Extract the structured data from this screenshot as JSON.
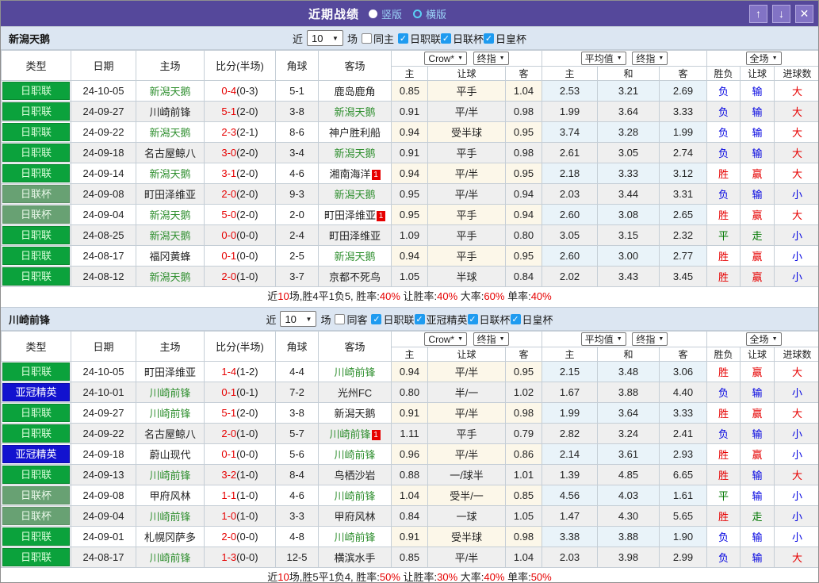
{
  "titlebar": {
    "title": "近期战绩",
    "radio_vertical": "竖版",
    "radio_horizontal": "横版",
    "up_glyph": "↑",
    "down_glyph": "↓",
    "close_glyph": "✕"
  },
  "columns": {
    "type": "类型",
    "date": "日期",
    "home": "主场",
    "score": "比分(半场)",
    "corner": "角球",
    "away": "客场",
    "handicap_src": "Crow*",
    "handicap_idx": "终指",
    "let_sub": [
      "主",
      "让球",
      "客"
    ],
    "avg_src": "平均值",
    "avg_idx": "终指",
    "avg_sub": [
      "主",
      "和",
      "客"
    ],
    "full_src": "全场",
    "full_sub": [
      "胜负",
      "让球",
      "进球数"
    ]
  },
  "colors": {
    "titlebar_bg": "#55489B",
    "titlebar_btn_bg": "#8273C5",
    "titlebar_btn_border": "#B3A8DF",
    "radio_label": "#9AD2F7",
    "section_header_bg": "#DCE6F2",
    "grid_border": "#C5CED6",
    "row_alt": "#EFEFEF",
    "col_let": "#FCF7E9",
    "col_avg": "#E9F3F9",
    "checkbox_blue": "#1E9BF0",
    "league_jl_bg": "#0BA23C",
    "league_jl_border": "#0A8830",
    "league_jl_text": "#DCFFDC",
    "league_cup_bg": "#68A173",
    "league_cup_border": "#5C9066",
    "league_cup_text": "#E8F7E8",
    "league_acl_bg": "#1212CF",
    "league_acl_border": "#0B0BA8",
    "team_hl": "#2F8F2F",
    "red": "#E60000",
    "blue": "#0000E0",
    "green": "#007800"
  },
  "sections": [
    {
      "team": "新潟天鹅",
      "filter": {
        "near_label": "近",
        "count": "10",
        "games_label": "场",
        "same_label": "同主",
        "same_checked": false,
        "leagues": [
          {
            "label": "日职联",
            "checked": true
          },
          {
            "label": "日联杯",
            "checked": true
          },
          {
            "label": "日皇杯",
            "checked": true
          }
        ]
      },
      "rows": [
        {
          "league": "日职联",
          "date": "24-10-05",
          "home": "新潟天鹅",
          "hh": true,
          "hrc": false,
          "score": "0-4",
          "half": "(0-3)",
          "corner": "5-1",
          "away": "鹿岛鹿角",
          "ah": false,
          "arc": false,
          "let": [
            "0.85",
            "平手",
            "1.04"
          ],
          "avg": [
            "2.53",
            "3.21",
            "2.69"
          ],
          "res": [
            "负",
            "输",
            "大"
          ]
        },
        {
          "league": "日职联",
          "date": "24-09-27",
          "home": "川崎前锋",
          "hh": false,
          "hrc": false,
          "score": "5-1",
          "half": "(2-0)",
          "corner": "3-8",
          "away": "新潟天鹅",
          "ah": true,
          "arc": false,
          "let": [
            "0.91",
            "平/半",
            "0.98"
          ],
          "avg": [
            "1.99",
            "3.64",
            "3.33"
          ],
          "res": [
            "负",
            "输",
            "大"
          ]
        },
        {
          "league": "日职联",
          "date": "24-09-22",
          "home": "新潟天鹅",
          "hh": true,
          "hrc": false,
          "score": "2-3",
          "half": "(2-1)",
          "corner": "8-6",
          "away": "神户胜利船",
          "ah": false,
          "arc": false,
          "let": [
            "0.94",
            "受半球",
            "0.95"
          ],
          "avg": [
            "3.74",
            "3.28",
            "1.99"
          ],
          "res": [
            "负",
            "输",
            "大"
          ]
        },
        {
          "league": "日职联",
          "date": "24-09-18",
          "home": "名古屋鲸八",
          "hh": false,
          "hrc": false,
          "score": "3-0",
          "half": "(2-0)",
          "corner": "3-4",
          "away": "新潟天鹅",
          "ah": true,
          "arc": false,
          "let": [
            "0.91",
            "平手",
            "0.98"
          ],
          "avg": [
            "2.61",
            "3.05",
            "2.74"
          ],
          "res": [
            "负",
            "输",
            "大"
          ]
        },
        {
          "league": "日职联",
          "date": "24-09-14",
          "home": "新潟天鹅",
          "hh": true,
          "hrc": false,
          "score": "3-1",
          "half": "(2-0)",
          "corner": "4-6",
          "away": "湘南海洋",
          "ah": false,
          "arc": true,
          "let": [
            "0.94",
            "平/半",
            "0.95"
          ],
          "avg": [
            "2.18",
            "3.33",
            "3.12"
          ],
          "res": [
            "胜",
            "赢",
            "大"
          ]
        },
        {
          "league": "日联杯",
          "date": "24-09-08",
          "home": "町田泽维亚",
          "hh": false,
          "hrc": false,
          "score": "2-0",
          "half": "(2-0)",
          "corner": "9-3",
          "away": "新潟天鹅",
          "ah": true,
          "arc": false,
          "let": [
            "0.95",
            "平/半",
            "0.94"
          ],
          "avg": [
            "2.03",
            "3.44",
            "3.31"
          ],
          "res": [
            "负",
            "输",
            "小"
          ]
        },
        {
          "league": "日联杯",
          "date": "24-09-04",
          "home": "新潟天鹅",
          "hh": true,
          "hrc": false,
          "score": "5-0",
          "half": "(2-0)",
          "corner": "2-0",
          "away": "町田泽维亚",
          "ah": false,
          "arc": true,
          "let": [
            "0.95",
            "平手",
            "0.94"
          ],
          "avg": [
            "2.60",
            "3.08",
            "2.65"
          ],
          "res": [
            "胜",
            "赢",
            "大"
          ]
        },
        {
          "league": "日职联",
          "date": "24-08-25",
          "home": "新潟天鹅",
          "hh": true,
          "hrc": false,
          "score": "0-0",
          "half": "(0-0)",
          "corner": "2-4",
          "away": "町田泽维亚",
          "ah": false,
          "arc": false,
          "let": [
            "1.09",
            "平手",
            "0.80"
          ],
          "avg": [
            "3.05",
            "3.15",
            "2.32"
          ],
          "res": [
            "平",
            "走",
            "小"
          ]
        },
        {
          "league": "日职联",
          "date": "24-08-17",
          "home": "福冈黄蜂",
          "hh": false,
          "hrc": false,
          "score": "0-1",
          "half": "(0-0)",
          "corner": "2-5",
          "away": "新潟天鹅",
          "ah": true,
          "arc": false,
          "let": [
            "0.94",
            "平手",
            "0.95"
          ],
          "avg": [
            "2.60",
            "3.00",
            "2.77"
          ],
          "res": [
            "胜",
            "赢",
            "小"
          ]
        },
        {
          "league": "日职联",
          "date": "24-08-12",
          "home": "新潟天鹅",
          "hh": true,
          "hrc": false,
          "score": "2-0",
          "half": "(1-0)",
          "corner": "3-7",
          "away": "京都不死鸟",
          "ah": false,
          "arc": false,
          "let": [
            "1.05",
            "半球",
            "0.84"
          ],
          "avg": [
            "2.02",
            "3.43",
            "3.45"
          ],
          "res": [
            "胜",
            "赢",
            "小"
          ]
        }
      ],
      "summary": [
        {
          "t": "近"
        },
        {
          "t": "10",
          "red": true
        },
        {
          "t": "场,胜4平1负5, 胜率:"
        },
        {
          "t": "40%",
          "red": true
        },
        {
          "t": " 让胜率:"
        },
        {
          "t": "40%",
          "red": true
        },
        {
          "t": " 大率:"
        },
        {
          "t": "60%",
          "red": true
        },
        {
          "t": " 单率:"
        },
        {
          "t": "40%",
          "red": true
        }
      ]
    },
    {
      "team": "川崎前锋",
      "filter": {
        "near_label": "近",
        "count": "10",
        "games_label": "场",
        "same_label": "同客",
        "same_checked": false,
        "leagues": [
          {
            "label": "日职联",
            "checked": true
          },
          {
            "label": "亚冠精英",
            "checked": true
          },
          {
            "label": "日联杯",
            "checked": true
          },
          {
            "label": "日皇杯",
            "checked": true
          }
        ]
      },
      "rows": [
        {
          "league": "日职联",
          "date": "24-10-05",
          "home": "町田泽维亚",
          "hh": false,
          "hrc": false,
          "score": "1-4",
          "half": "(1-2)",
          "corner": "4-4",
          "away": "川崎前锋",
          "ah": true,
          "arc": false,
          "let": [
            "0.94",
            "平/半",
            "0.95"
          ],
          "avg": [
            "2.15",
            "3.48",
            "3.06"
          ],
          "res": [
            "胜",
            "赢",
            "大"
          ]
        },
        {
          "league": "亚冠精英",
          "date": "24-10-01",
          "home": "川崎前锋",
          "hh": true,
          "hrc": false,
          "score": "0-1",
          "half": "(0-1)",
          "corner": "7-2",
          "away": "光州FC",
          "ah": false,
          "arc": false,
          "let": [
            "0.80",
            "半/一",
            "1.02"
          ],
          "avg": [
            "1.67",
            "3.88",
            "4.40"
          ],
          "res": [
            "负",
            "输",
            "小"
          ]
        },
        {
          "league": "日职联",
          "date": "24-09-27",
          "home": "川崎前锋",
          "hh": true,
          "hrc": false,
          "score": "5-1",
          "half": "(2-0)",
          "corner": "3-8",
          "away": "新潟天鹅",
          "ah": false,
          "arc": false,
          "let": [
            "0.91",
            "平/半",
            "0.98"
          ],
          "avg": [
            "1.99",
            "3.64",
            "3.33"
          ],
          "res": [
            "胜",
            "赢",
            "大"
          ]
        },
        {
          "league": "日职联",
          "date": "24-09-22",
          "home": "名古屋鲸八",
          "hh": false,
          "hrc": false,
          "score": "2-0",
          "half": "(1-0)",
          "corner": "5-7",
          "away": "川崎前锋",
          "ah": true,
          "arc": true,
          "let": [
            "1.11",
            "平手",
            "0.79"
          ],
          "avg": [
            "2.82",
            "3.24",
            "2.41"
          ],
          "res": [
            "负",
            "输",
            "小"
          ]
        },
        {
          "league": "亚冠精英",
          "date": "24-09-18",
          "home": "蔚山现代",
          "hh": false,
          "hrc": false,
          "score": "0-1",
          "half": "(0-0)",
          "corner": "5-6",
          "away": "川崎前锋",
          "ah": true,
          "arc": false,
          "let": [
            "0.96",
            "平/半",
            "0.86"
          ],
          "avg": [
            "2.14",
            "3.61",
            "2.93"
          ],
          "res": [
            "胜",
            "赢",
            "小"
          ]
        },
        {
          "league": "日职联",
          "date": "24-09-13",
          "home": "川崎前锋",
          "hh": true,
          "hrc": false,
          "score": "3-2",
          "half": "(1-0)",
          "corner": "8-4",
          "away": "鸟栖沙岩",
          "ah": false,
          "arc": false,
          "let": [
            "0.88",
            "一/球半",
            "1.01"
          ],
          "avg": [
            "1.39",
            "4.85",
            "6.65"
          ],
          "res": [
            "胜",
            "输",
            "大"
          ]
        },
        {
          "league": "日联杯",
          "date": "24-09-08",
          "home": "甲府风林",
          "hh": false,
          "hrc": false,
          "score": "1-1",
          "half": "(1-0)",
          "corner": "4-6",
          "away": "川崎前锋",
          "ah": true,
          "arc": false,
          "let": [
            "1.04",
            "受半/一",
            "0.85"
          ],
          "avg": [
            "4.56",
            "4.03",
            "1.61"
          ],
          "res": [
            "平",
            "输",
            "小"
          ]
        },
        {
          "league": "日联杯",
          "date": "24-09-04",
          "home": "川崎前锋",
          "hh": true,
          "hrc": false,
          "score": "1-0",
          "half": "(1-0)",
          "corner": "3-3",
          "away": "甲府风林",
          "ah": false,
          "arc": false,
          "let": [
            "0.84",
            "一球",
            "1.05"
          ],
          "avg": [
            "1.47",
            "4.30",
            "5.65"
          ],
          "res": [
            "胜",
            "走",
            "小"
          ]
        },
        {
          "league": "日职联",
          "date": "24-09-01",
          "home": "札幌冈萨多",
          "hh": false,
          "hrc": false,
          "score": "2-0",
          "half": "(0-0)",
          "corner": "4-8",
          "away": "川崎前锋",
          "ah": true,
          "arc": false,
          "let": [
            "0.91",
            "受半球",
            "0.98"
          ],
          "avg": [
            "3.38",
            "3.88",
            "1.90"
          ],
          "res": [
            "负",
            "输",
            "小"
          ]
        },
        {
          "league": "日职联",
          "date": "24-08-17",
          "home": "川崎前锋",
          "hh": true,
          "hrc": false,
          "score": "1-3",
          "half": "(0-0)",
          "corner": "12-5",
          "away": "横滨水手",
          "ah": false,
          "arc": false,
          "let": [
            "0.85",
            "平/半",
            "1.04"
          ],
          "avg": [
            "2.03",
            "3.98",
            "2.99"
          ],
          "res": [
            "负",
            "输",
            "大"
          ]
        }
      ],
      "summary": [
        {
          "t": "近"
        },
        {
          "t": "10",
          "red": true
        },
        {
          "t": "场,胜5平1负4, 胜率:"
        },
        {
          "t": "50%",
          "red": true
        },
        {
          "t": " 让胜率:"
        },
        {
          "t": "30%",
          "red": true
        },
        {
          "t": " 大率:"
        },
        {
          "t": "40%",
          "red": true
        },
        {
          "t": " 单率:"
        },
        {
          "t": "50%",
          "red": true
        }
      ]
    }
  ]
}
